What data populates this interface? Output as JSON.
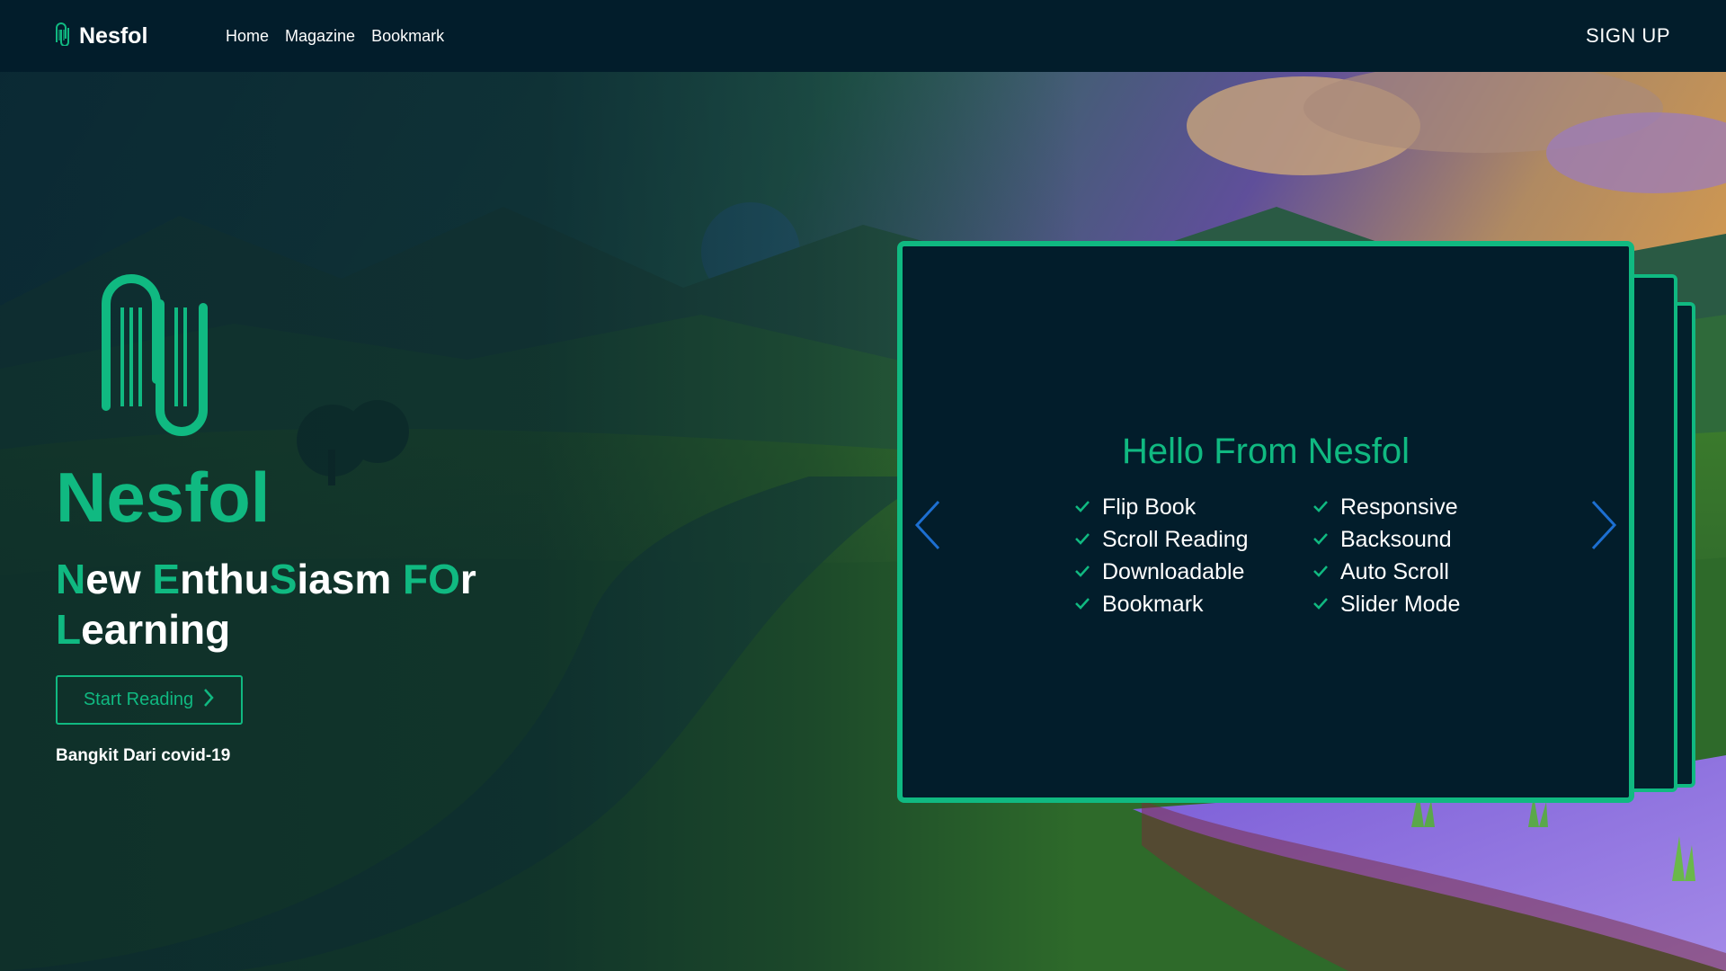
{
  "nav": {
    "brand": "Nesfol",
    "links": [
      "Home",
      "Magazine",
      "Bookmark"
    ],
    "signup": "SIGN UP"
  },
  "hero": {
    "title": "Nesfol",
    "tagline": [
      {
        "text": "N",
        "accent": true
      },
      {
        "text": "ew ",
        "accent": false
      },
      {
        "text": "E",
        "accent": true
      },
      {
        "text": "nthu",
        "accent": false
      },
      {
        "text": "S",
        "accent": true
      },
      {
        "text": "iasm ",
        "accent": false
      },
      {
        "text": "FO",
        "accent": true
      },
      {
        "text": "r ",
        "accent": false
      },
      {
        "text": "L",
        "accent": true
      },
      {
        "text": "earning",
        "accent": false
      }
    ],
    "button_label": "Start Reading",
    "subtext": "Bangkit Dari covid-19"
  },
  "book": {
    "title": "Hello From Nesfol",
    "features": [
      "Flip Book",
      "Responsive",
      "Scroll Reading",
      "Backsound",
      "Downloadable",
      "Auto Scroll",
      "Bookmark",
      "Slider Mode"
    ]
  },
  "colors": {
    "accent": "#10b981",
    "navbar": "#021d2b",
    "card": "#021d2b",
    "arrow": "#1d6fd1"
  },
  "icons": {
    "logo": "paperclip-book-icon",
    "button": "chevron-right-icon",
    "feature": "check-icon",
    "prev": "chevron-left-icon",
    "next": "chevron-right-icon"
  }
}
